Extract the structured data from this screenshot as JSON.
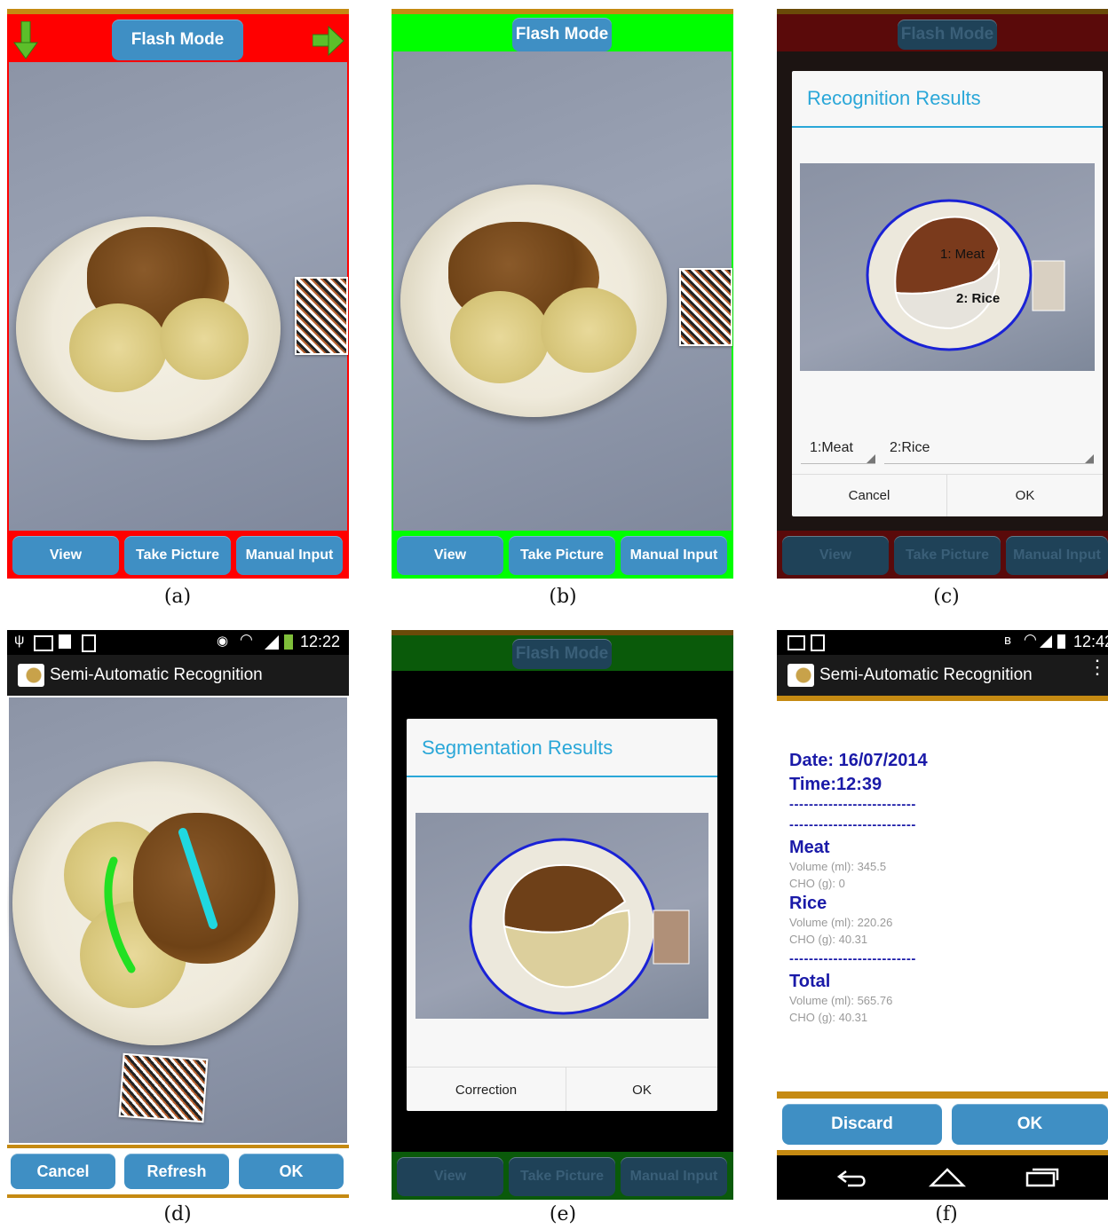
{
  "captions": [
    "(a)",
    "(b)",
    "(c)",
    "(d)",
    "(e)",
    "(f)"
  ],
  "camera": {
    "flash_label": "Flash Mode",
    "buttons": [
      "View",
      "Take Picture",
      "Manual Input"
    ]
  },
  "recognition_dialog": {
    "title": "Recognition Results",
    "overlay_labels": [
      "1: Meat",
      "2: Rice"
    ],
    "spinners": [
      "1:Meat",
      "2:Rice"
    ],
    "cancel": "Cancel",
    "ok": "OK"
  },
  "semi_auto": {
    "status_time": "12:22",
    "app_title": "Semi-Automatic Recognition",
    "buttons": [
      "Cancel",
      "Refresh",
      "OK"
    ]
  },
  "segmentation_dialog": {
    "title": "Segmentation Results",
    "correction": "Correction",
    "ok": "OK"
  },
  "results": {
    "status_time": "12:42",
    "app_title": "Semi-Automatic Recognition",
    "date": "Date: 16/07/2014",
    "time": "Time:12:39",
    "separator": "--------------------------",
    "items": [
      {
        "name": "Meat",
        "volume": "Volume (ml):  345.5",
        "cho": "CHO (g):  0"
      },
      {
        "name": "Rice",
        "volume": "Volume (ml):  220.26",
        "cho": "CHO (g):  40.31"
      }
    ],
    "total": {
      "name": "Total",
      "volume": "Volume (ml):  565.76",
      "cho": "CHO (g):  40.31"
    },
    "discard": "Discard",
    "ok": "OK"
  },
  "colors": {
    "flash_off_bar": "#ff0000",
    "flash_on_bar": "#00ff00",
    "button_blue": "#3f8fc4",
    "dialog_title": "#2aa7d8",
    "results_text": "#1a1aa8",
    "gold_rule": "#c58a12"
  }
}
